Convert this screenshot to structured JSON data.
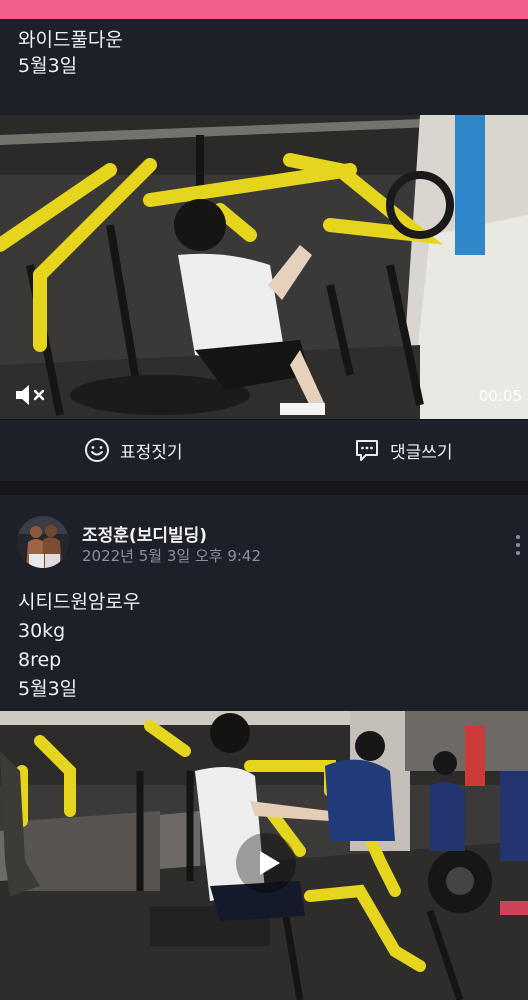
{
  "post1": {
    "lines": [
      "와이드풀다운",
      "5월3일"
    ],
    "video": {
      "duration": "00:05",
      "muted": true
    }
  },
  "actions": {
    "emote_label": "표정짓기",
    "comment_label": "댓글쓰기"
  },
  "post2": {
    "author": "조정훈(보디빌딩)",
    "timestamp": "2022년 5월 3일 오후 9:42",
    "lines": [
      "시티드원암로우",
      "30kg",
      "8rep",
      "5월3일"
    ]
  },
  "colors": {
    "accent_bar": "#f25f8b",
    "background": "#1d2029",
    "machine_yellow": "#e5d51c"
  },
  "icons": [
    "mute-icon",
    "smile-icon",
    "comment-icon",
    "more-icon",
    "play-icon"
  ]
}
